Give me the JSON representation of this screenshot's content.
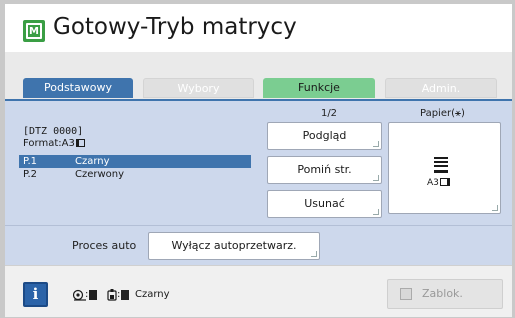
{
  "header": {
    "icon": "master-mode-icon",
    "icon_letter": "M",
    "title": "Gotowy-Tryb matrycy"
  },
  "tabs": [
    {
      "label": "Podstawowy",
      "state": "active"
    },
    {
      "label": "Wybory",
      "state": "disabled"
    },
    {
      "label": "Funkcje",
      "state": "normal"
    },
    {
      "label": "Admin.",
      "state": "disabled"
    }
  ],
  "job": {
    "id": "[DTZ 0000]",
    "format": "Format:A3",
    "pages": [
      {
        "num": "P.1",
        "color": "Czarny",
        "selected": true
      },
      {
        "num": "P.2",
        "color": "Czerwony",
        "selected": false
      }
    ]
  },
  "controls": {
    "pager": "1/2",
    "preview": "Podgląd",
    "skip": "Pomiń str.",
    "delete": "Usunać"
  },
  "paper": {
    "label": "Papier(⚹)",
    "size": "A3"
  },
  "auto": {
    "label": "Proces auto",
    "button": "Wyłącz autoprzetwarz."
  },
  "footer": {
    "info": "i",
    "ink_color": "Czarny",
    "lock": "Zablok.",
    "drum_sep": ":",
    "ink_sep": ":"
  },
  "colors": {
    "accent": "#3f74ad",
    "panel": "#cdd8ec",
    "functions_tab": "#7bcd91",
    "header_icon": "#3a9e44"
  }
}
